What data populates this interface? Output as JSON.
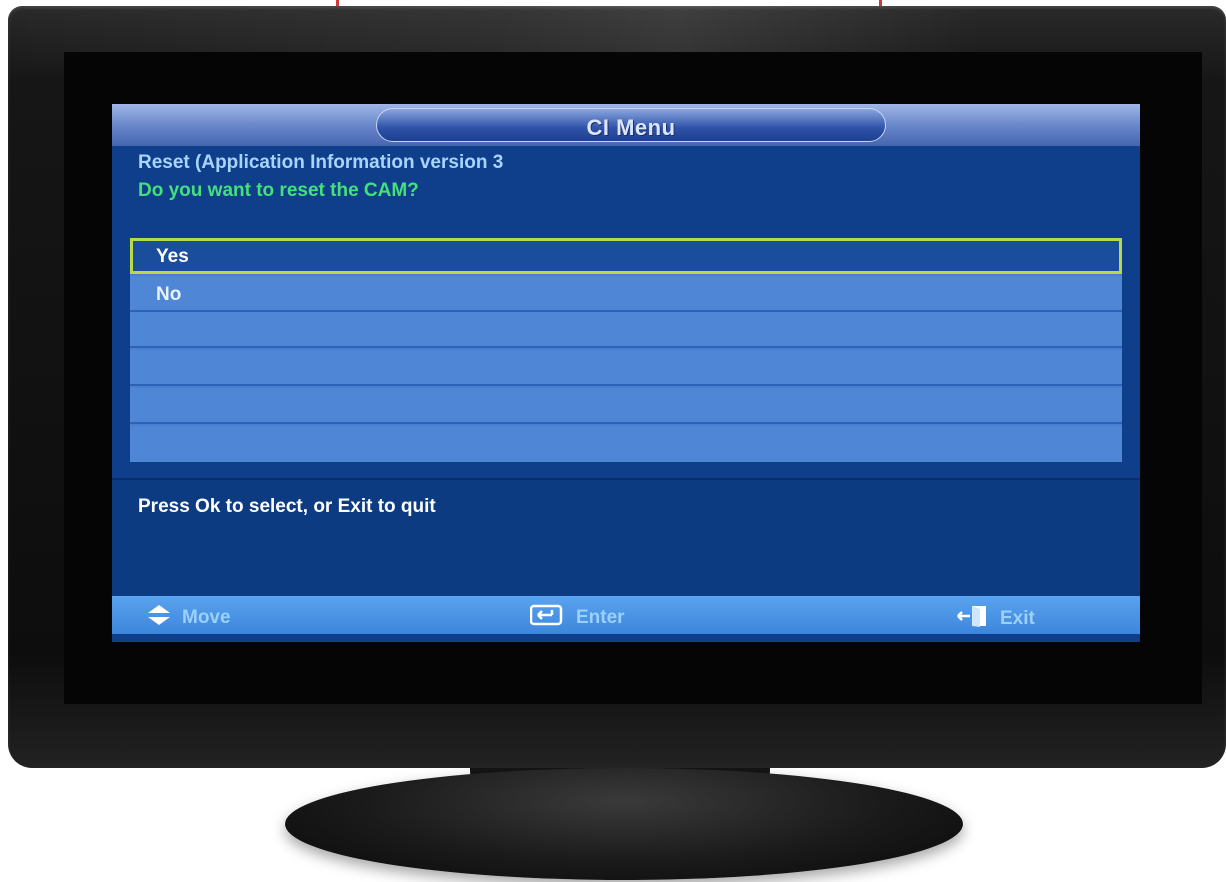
{
  "cimenu": {
    "title": "CI Menu",
    "info_line": "Reset (Application Information version 3",
    "question": "Do you want to reset the CAM?",
    "options": [
      {
        "label": "Yes",
        "selected": true
      },
      {
        "label": "No",
        "selected": false
      },
      {
        "label": ""
      },
      {
        "label": ""
      },
      {
        "label": ""
      },
      {
        "label": ""
      }
    ],
    "help_text": "Press Ok to select, or Exit to quit"
  },
  "footer": {
    "move_label": "Move",
    "move_icon": "up-down-arrows-icon",
    "enter_label": "Enter",
    "enter_icon": "enter-key-icon",
    "exit_label": "Exit",
    "exit_icon": "exit-door-icon"
  },
  "colors": {
    "menu_background": "#0f3f8a",
    "list_row": "#4f86d6",
    "selected_row": "#1a4d9c",
    "selection_border": "#b9d84a",
    "question_text": "#43e07b",
    "info_text": "#a8d4ff"
  }
}
